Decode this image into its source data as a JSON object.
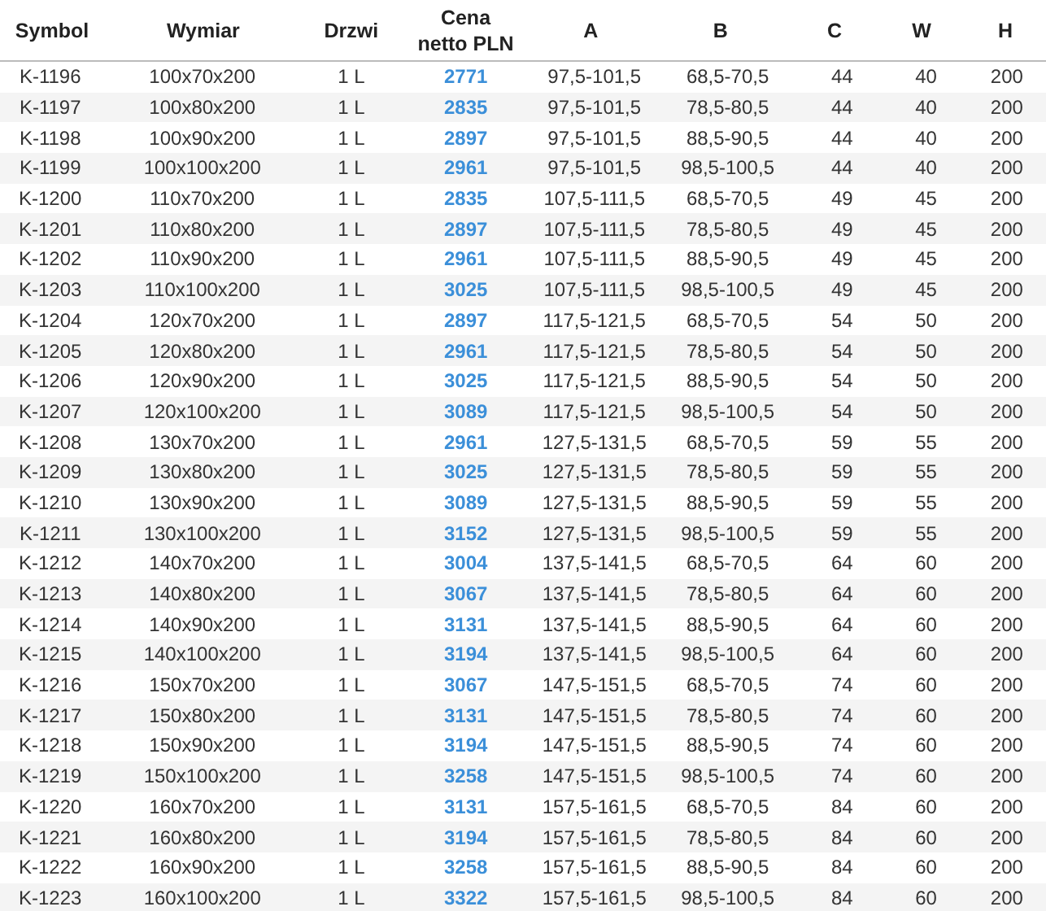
{
  "table": {
    "columns": [
      "Symbol",
      "Wymiar",
      "Drzwi",
      "Cena netto PLN",
      "A",
      "B",
      "C",
      "W",
      "H"
    ],
    "rows": [
      [
        "K-1196",
        "100x70x200",
        "1 L",
        "2771",
        "97,5-101,5",
        "68,5-70,5",
        "44",
        "40",
        "200"
      ],
      [
        "K-1197",
        "100x80x200",
        "1 L",
        "2835",
        "97,5-101,5",
        "78,5-80,5",
        "44",
        "40",
        "200"
      ],
      [
        "K-1198",
        "100x90x200",
        "1 L",
        "2897",
        "97,5-101,5",
        "88,5-90,5",
        "44",
        "40",
        "200"
      ],
      [
        "K-1199",
        "100x100x200",
        "1 L",
        "2961",
        "97,5-101,5",
        "98,5-100,5",
        "44",
        "40",
        "200"
      ],
      [
        "K-1200",
        "110x70x200",
        "1 L",
        "2835",
        "107,5-111,5",
        "68,5-70,5",
        "49",
        "45",
        "200"
      ],
      [
        "K-1201",
        "110x80x200",
        "1 L",
        "2897",
        "107,5-111,5",
        "78,5-80,5",
        "49",
        "45",
        "200"
      ],
      [
        "K-1202",
        "110x90x200",
        "1 L",
        "2961",
        "107,5-111,5",
        "88,5-90,5",
        "49",
        "45",
        "200"
      ],
      [
        "K-1203",
        "110x100x200",
        "1 L",
        "3025",
        "107,5-111,5",
        "98,5-100,5",
        "49",
        "45",
        "200"
      ],
      [
        "K-1204",
        "120x70x200",
        "1 L",
        "2897",
        "117,5-121,5",
        "68,5-70,5",
        "54",
        "50",
        "200"
      ],
      [
        "K-1205",
        "120x80x200",
        "1 L",
        "2961",
        "117,5-121,5",
        "78,5-80,5",
        "54",
        "50",
        "200"
      ],
      [
        "K-1206",
        "120x90x200",
        "1 L",
        "3025",
        "117,5-121,5",
        "88,5-90,5",
        "54",
        "50",
        "200"
      ],
      [
        "K-1207",
        "120x100x200",
        "1 L",
        "3089",
        "117,5-121,5",
        "98,5-100,5",
        "54",
        "50",
        "200"
      ],
      [
        "K-1208",
        "130x70x200",
        "1 L",
        "2961",
        "127,5-131,5",
        "68,5-70,5",
        "59",
        "55",
        "200"
      ],
      [
        "K-1209",
        "130x80x200",
        "1 L",
        "3025",
        "127,5-131,5",
        "78,5-80,5",
        "59",
        "55",
        "200"
      ],
      [
        "K-1210",
        "130x90x200",
        "1 L",
        "3089",
        "127,5-131,5",
        "88,5-90,5",
        "59",
        "55",
        "200"
      ],
      [
        "K-1211",
        "130x100x200",
        "1 L",
        "3152",
        "127,5-131,5",
        "98,5-100,5",
        "59",
        "55",
        "200"
      ],
      [
        "K-1212",
        "140x70x200",
        "1 L",
        "3004",
        "137,5-141,5",
        "68,5-70,5",
        "64",
        "60",
        "200"
      ],
      [
        "K-1213",
        "140x80x200",
        "1 L",
        "3067",
        "137,5-141,5",
        "78,5-80,5",
        "64",
        "60",
        "200"
      ],
      [
        "K-1214",
        "140x90x200",
        "1 L",
        "3131",
        "137,5-141,5",
        "88,5-90,5",
        "64",
        "60",
        "200"
      ],
      [
        "K-1215",
        "140x100x200",
        "1 L",
        "3194",
        "137,5-141,5",
        "98,5-100,5",
        "64",
        "60",
        "200"
      ],
      [
        "K-1216",
        "150x70x200",
        "1 L",
        "3067",
        "147,5-151,5",
        "68,5-70,5",
        "74",
        "60",
        "200"
      ],
      [
        "K-1217",
        "150x80x200",
        "1 L",
        "3131",
        "147,5-151,5",
        "78,5-80,5",
        "74",
        "60",
        "200"
      ],
      [
        "K-1218",
        "150x90x200",
        "1 L",
        "3194",
        "147,5-151,5",
        "88,5-90,5",
        "74",
        "60",
        "200"
      ],
      [
        "K-1219",
        "150x100x200",
        "1 L",
        "3258",
        "147,5-151,5",
        "98,5-100,5",
        "74",
        "60",
        "200"
      ],
      [
        "K-1220",
        "160x70x200",
        "1 L",
        "3131",
        "157,5-161,5",
        "68,5-70,5",
        "84",
        "60",
        "200"
      ],
      [
        "K-1221",
        "160x80x200",
        "1 L",
        "3194",
        "157,5-161,5",
        "78,5-80,5",
        "84",
        "60",
        "200"
      ],
      [
        "K-1222",
        "160x90x200",
        "1 L",
        "3258",
        "157,5-161,5",
        "88,5-90,5",
        "84",
        "60",
        "200"
      ],
      [
        "K-1223",
        "160x100x200",
        "1 L",
        "3322",
        "157,5-161,5",
        "98,5-100,5",
        "84",
        "60",
        "200"
      ]
    ]
  }
}
